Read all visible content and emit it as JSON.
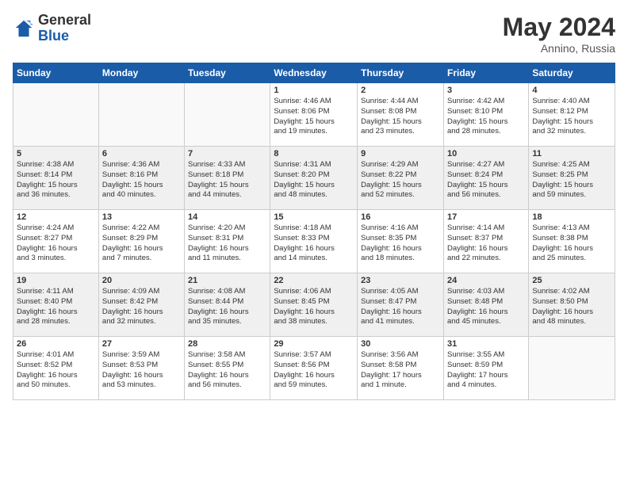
{
  "header": {
    "logo_general": "General",
    "logo_blue": "Blue",
    "month_year": "May 2024",
    "location": "Annino, Russia"
  },
  "days_of_week": [
    "Sunday",
    "Monday",
    "Tuesday",
    "Wednesday",
    "Thursday",
    "Friday",
    "Saturday"
  ],
  "weeks": [
    [
      {
        "day": "",
        "info": ""
      },
      {
        "day": "",
        "info": ""
      },
      {
        "day": "",
        "info": ""
      },
      {
        "day": "1",
        "info": "Sunrise: 4:46 AM\nSunset: 8:06 PM\nDaylight: 15 hours\nand 19 minutes."
      },
      {
        "day": "2",
        "info": "Sunrise: 4:44 AM\nSunset: 8:08 PM\nDaylight: 15 hours\nand 23 minutes."
      },
      {
        "day": "3",
        "info": "Sunrise: 4:42 AM\nSunset: 8:10 PM\nDaylight: 15 hours\nand 28 minutes."
      },
      {
        "day": "4",
        "info": "Sunrise: 4:40 AM\nSunset: 8:12 PM\nDaylight: 15 hours\nand 32 minutes."
      }
    ],
    [
      {
        "day": "5",
        "info": "Sunrise: 4:38 AM\nSunset: 8:14 PM\nDaylight: 15 hours\nand 36 minutes."
      },
      {
        "day": "6",
        "info": "Sunrise: 4:36 AM\nSunset: 8:16 PM\nDaylight: 15 hours\nand 40 minutes."
      },
      {
        "day": "7",
        "info": "Sunrise: 4:33 AM\nSunset: 8:18 PM\nDaylight: 15 hours\nand 44 minutes."
      },
      {
        "day": "8",
        "info": "Sunrise: 4:31 AM\nSunset: 8:20 PM\nDaylight: 15 hours\nand 48 minutes."
      },
      {
        "day": "9",
        "info": "Sunrise: 4:29 AM\nSunset: 8:22 PM\nDaylight: 15 hours\nand 52 minutes."
      },
      {
        "day": "10",
        "info": "Sunrise: 4:27 AM\nSunset: 8:24 PM\nDaylight: 15 hours\nand 56 minutes."
      },
      {
        "day": "11",
        "info": "Sunrise: 4:25 AM\nSunset: 8:25 PM\nDaylight: 15 hours\nand 59 minutes."
      }
    ],
    [
      {
        "day": "12",
        "info": "Sunrise: 4:24 AM\nSunset: 8:27 PM\nDaylight: 16 hours\nand 3 minutes."
      },
      {
        "day": "13",
        "info": "Sunrise: 4:22 AM\nSunset: 8:29 PM\nDaylight: 16 hours\nand 7 minutes."
      },
      {
        "day": "14",
        "info": "Sunrise: 4:20 AM\nSunset: 8:31 PM\nDaylight: 16 hours\nand 11 minutes."
      },
      {
        "day": "15",
        "info": "Sunrise: 4:18 AM\nSunset: 8:33 PM\nDaylight: 16 hours\nand 14 minutes."
      },
      {
        "day": "16",
        "info": "Sunrise: 4:16 AM\nSunset: 8:35 PM\nDaylight: 16 hours\nand 18 minutes."
      },
      {
        "day": "17",
        "info": "Sunrise: 4:14 AM\nSunset: 8:37 PM\nDaylight: 16 hours\nand 22 minutes."
      },
      {
        "day": "18",
        "info": "Sunrise: 4:13 AM\nSunset: 8:38 PM\nDaylight: 16 hours\nand 25 minutes."
      }
    ],
    [
      {
        "day": "19",
        "info": "Sunrise: 4:11 AM\nSunset: 8:40 PM\nDaylight: 16 hours\nand 28 minutes."
      },
      {
        "day": "20",
        "info": "Sunrise: 4:09 AM\nSunset: 8:42 PM\nDaylight: 16 hours\nand 32 minutes."
      },
      {
        "day": "21",
        "info": "Sunrise: 4:08 AM\nSunset: 8:44 PM\nDaylight: 16 hours\nand 35 minutes."
      },
      {
        "day": "22",
        "info": "Sunrise: 4:06 AM\nSunset: 8:45 PM\nDaylight: 16 hours\nand 38 minutes."
      },
      {
        "day": "23",
        "info": "Sunrise: 4:05 AM\nSunset: 8:47 PM\nDaylight: 16 hours\nand 41 minutes."
      },
      {
        "day": "24",
        "info": "Sunrise: 4:03 AM\nSunset: 8:48 PM\nDaylight: 16 hours\nand 45 minutes."
      },
      {
        "day": "25",
        "info": "Sunrise: 4:02 AM\nSunset: 8:50 PM\nDaylight: 16 hours\nand 48 minutes."
      }
    ],
    [
      {
        "day": "26",
        "info": "Sunrise: 4:01 AM\nSunset: 8:52 PM\nDaylight: 16 hours\nand 50 minutes."
      },
      {
        "day": "27",
        "info": "Sunrise: 3:59 AM\nSunset: 8:53 PM\nDaylight: 16 hours\nand 53 minutes."
      },
      {
        "day": "28",
        "info": "Sunrise: 3:58 AM\nSunset: 8:55 PM\nDaylight: 16 hours\nand 56 minutes."
      },
      {
        "day": "29",
        "info": "Sunrise: 3:57 AM\nSunset: 8:56 PM\nDaylight: 16 hours\nand 59 minutes."
      },
      {
        "day": "30",
        "info": "Sunrise: 3:56 AM\nSunset: 8:58 PM\nDaylight: 17 hours\nand 1 minute."
      },
      {
        "day": "31",
        "info": "Sunrise: 3:55 AM\nSunset: 8:59 PM\nDaylight: 17 hours\nand 4 minutes."
      },
      {
        "day": "",
        "info": ""
      }
    ]
  ]
}
